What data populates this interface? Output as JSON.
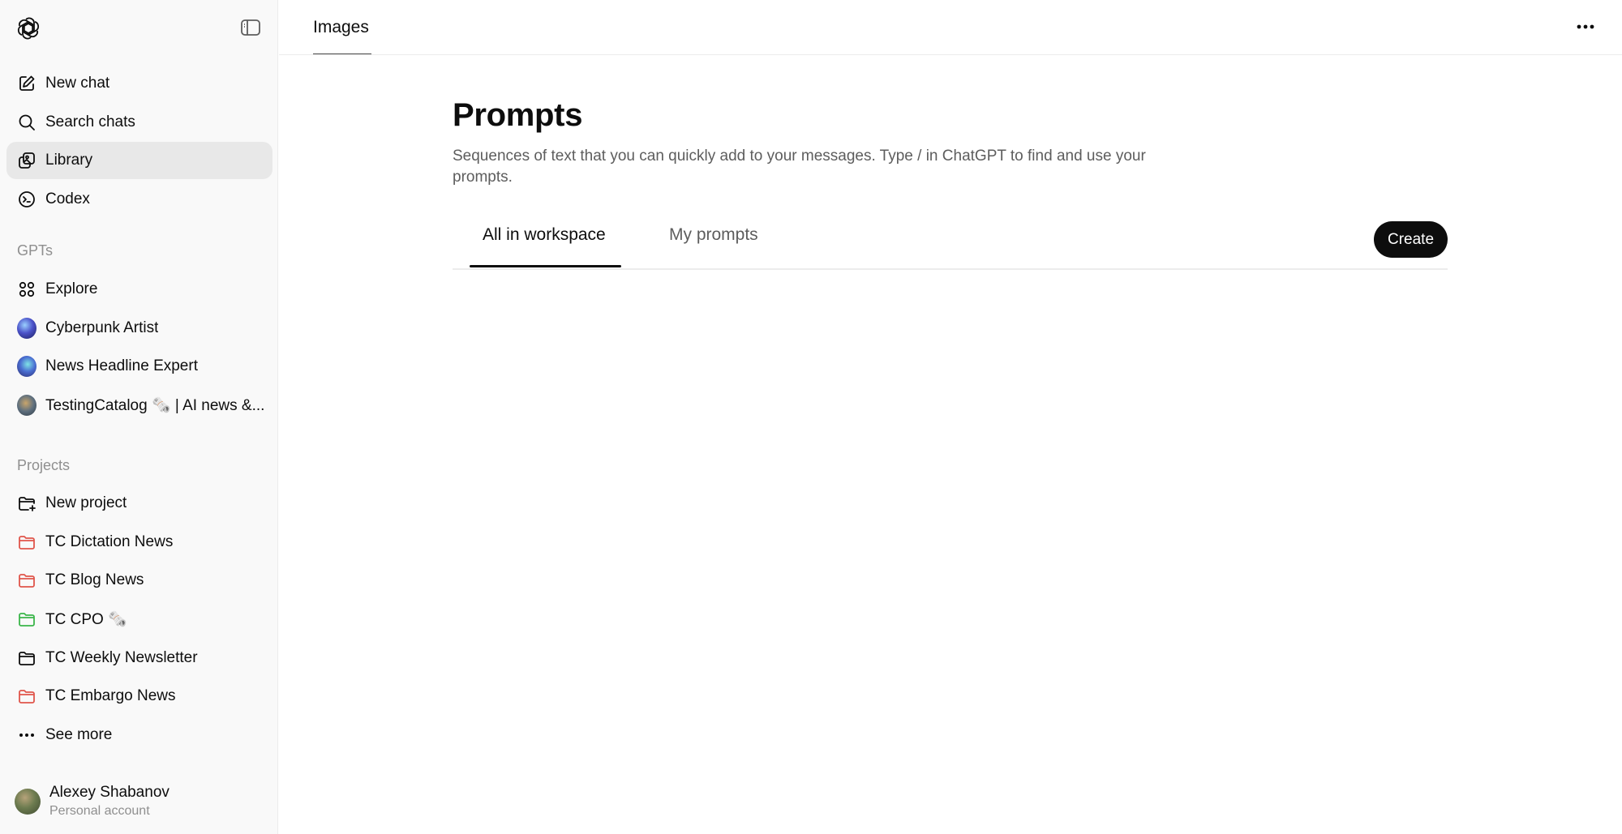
{
  "window": {
    "header_title": "Images"
  },
  "sidebar": {
    "main_items": [
      {
        "label": "New chat",
        "icon": "compose-icon"
      },
      {
        "label": "Search chats",
        "icon": "search-icon"
      },
      {
        "label": "Library",
        "icon": "library-icon",
        "active": true
      },
      {
        "label": "Codex",
        "icon": "codex-icon"
      }
    ],
    "gpts_heading": "GPTs",
    "gpts": [
      {
        "label": "Explore",
        "icon": "grid-icon"
      },
      {
        "label": "Cyberpunk Artist",
        "icon": "gpt-avatar"
      },
      {
        "label": "News Headline Expert",
        "icon": "gpt-avatar"
      },
      {
        "label": "TestingCatalog 🗞️ | AI news &...",
        "icon": "gpt-avatar"
      }
    ],
    "projects_heading": "Projects",
    "projects": [
      {
        "label": "New project",
        "icon": "folder-plus-icon"
      },
      {
        "label": "TC Dictation News",
        "icon": "folder-icon",
        "color": "#e0554b"
      },
      {
        "label": "TC Blog News",
        "icon": "folder-icon",
        "color": "#e0554b"
      },
      {
        "label": "TC CPO 🗞️",
        "icon": "folder-icon",
        "color": "#3bb54a"
      },
      {
        "label": "TC Weekly Newsletter",
        "icon": "folder-icon",
        "color": "#0d0d0d"
      },
      {
        "label": "TC Embargo News",
        "icon": "folder-icon",
        "color": "#e0554b"
      }
    ],
    "see_more": "See more",
    "user": {
      "name": "Alexey Shabanov",
      "account": "Personal account"
    }
  },
  "main": {
    "title": "Prompts",
    "description": "Sequences of text that you can quickly add to your messages. Type / in ChatGPT to find and use your prompts.",
    "tabs": [
      {
        "label": "All in workspace",
        "active": true
      },
      {
        "label": "My prompts",
        "active": false
      }
    ],
    "create_label": "Create"
  },
  "colors": {
    "accent": "#0d0d0d",
    "sidebar_bg": "#f9f9f9",
    "active_item_bg": "#e8e8e8",
    "muted_text": "#8f8f8f"
  }
}
